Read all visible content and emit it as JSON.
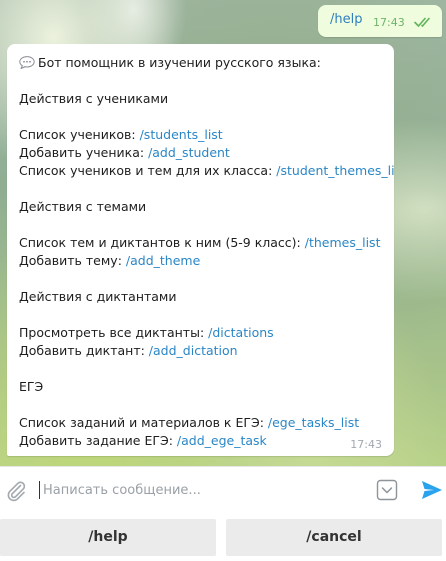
{
  "outgoing": {
    "text": "/help",
    "time": "17:43",
    "read_icon": "double-check-icon"
  },
  "bot_message": {
    "intro_icon": "speech-bubble-icon",
    "intro": "Бот помощник в изучении русского языка:",
    "section_students": "Действия с учениками",
    "students_list_label": "Список учеников: ",
    "students_list_cmd": "/students_list",
    "add_student_label": "Добавить ученика: ",
    "add_student_cmd": "/add_student",
    "student_themes_label": "Список учеников и тем для их класса: ",
    "student_themes_cmd": "/student_themes_list",
    "section_themes": "Действия с темами",
    "themes_list_label": "Список тем и диктантов к ним (5-9 класс): ",
    "themes_list_cmd": "/themes_list",
    "add_theme_label": "Добавить тему: ",
    "add_theme_cmd": "/add_theme",
    "section_dictations": "Действия с диктантами",
    "dictations_label": "Просмотреть все диктанты: ",
    "dictations_cmd": "/dictations",
    "add_dictation_label": "Добавить диктант: ",
    "add_dictation_cmd": "/add_dictation",
    "section_ege": "ЕГЭ",
    "ege_tasks_label": "Список заданий и материалов к ЕГЭ: ",
    "ege_tasks_cmd": "/ege_tasks_list",
    "add_ege_task_label": "Добавить задание ЕГЭ: ",
    "add_ege_task_cmd": "/add_ege_task",
    "time": "17:43"
  },
  "composer": {
    "placeholder": "Написать сообщение...",
    "value": "",
    "attach_icon": "paperclip-icon",
    "emoji_icon": "chevron-down-box-icon",
    "send_icon": "send-arrow-icon"
  },
  "keyboard": {
    "help_label": "/help",
    "cancel_label": "/cancel"
  },
  "colors": {
    "link": "#2a86c6",
    "outgoing_bubble": "#effdde",
    "send_accent": "#2aa3ef"
  }
}
